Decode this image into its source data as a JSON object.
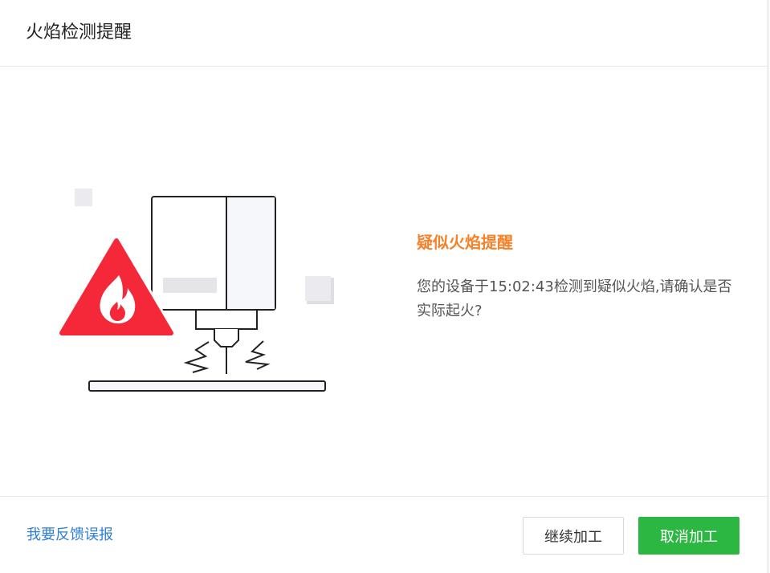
{
  "dialog": {
    "title": "火焰检测提醒"
  },
  "alert": {
    "heading": "疑似火焰提醒",
    "message": "您的设备于15:02:43检测到疑似火焰,请确认是否实际起火?"
  },
  "footer": {
    "feedback_link": "我要反馈误报",
    "continue_label": "继续加工",
    "cancel_label": "取消加工"
  },
  "colors": {
    "heading": "#f5822b",
    "link": "#2f7fd6",
    "primary_button": "#2bb741",
    "warning_triangle": "#f5283a"
  },
  "icons": {
    "illustration": "laser-machine-illustration",
    "warning": "fire-warning-icon"
  }
}
